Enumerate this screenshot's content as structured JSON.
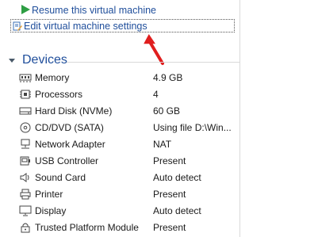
{
  "actions": {
    "resume_label": "Resume this virtual machine",
    "edit_settings_label": "Edit virtual machine settings"
  },
  "devices_section": {
    "title": "Devices",
    "items": [
      {
        "name": "Memory",
        "value": "4.9 GB",
        "icon": "memory-icon"
      },
      {
        "name": "Processors",
        "value": "4",
        "icon": "processor-icon"
      },
      {
        "name": "Hard Disk (NVMe)",
        "value": "60 GB",
        "icon": "hard-disk-icon"
      },
      {
        "name": "CD/DVD (SATA)",
        "value": "Using file D:\\Win...",
        "icon": "cd-dvd-icon"
      },
      {
        "name": "Network Adapter",
        "value": "NAT",
        "icon": "network-adapter-icon"
      },
      {
        "name": "USB Controller",
        "value": "Present",
        "icon": "usb-controller-icon"
      },
      {
        "name": "Sound Card",
        "value": "Auto detect",
        "icon": "sound-card-icon"
      },
      {
        "name": "Printer",
        "value": "Present",
        "icon": "printer-icon"
      },
      {
        "name": "Display",
        "value": "Auto detect",
        "icon": "display-icon"
      },
      {
        "name": "Trusted Platform Module",
        "value": "Present",
        "icon": "tpm-icon"
      }
    ]
  },
  "colors": {
    "link": "#1f4e9b",
    "play_icon": "#2e9e44",
    "annotation_arrow": "#e01e1e"
  }
}
